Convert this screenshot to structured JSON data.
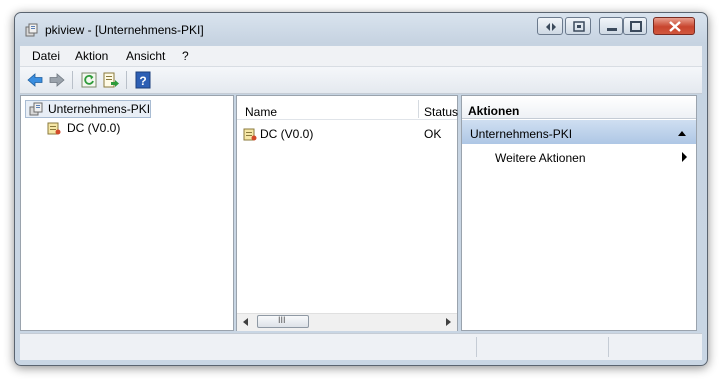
{
  "window": {
    "title": "pkiview - [Unternehmens-PKI]",
    "colors": {
      "frame": "#c9d6e4",
      "selection": "#b8cde8",
      "close": "#c8452e"
    }
  },
  "menu": {
    "items": [
      "Datei",
      "Aktion",
      "Ansicht",
      "?"
    ]
  },
  "toolbar": {
    "icons": [
      "back-arrow-icon",
      "forward-arrow-icon",
      "refresh-icon",
      "export-list-icon",
      "help-icon"
    ]
  },
  "tree": {
    "root": "Unternehmens-PKI",
    "children": [
      "DC (V0.0)"
    ]
  },
  "list": {
    "columns": [
      "Name",
      "Status"
    ],
    "rows": [
      {
        "name": "DC (V0.0)",
        "status": "OK"
      }
    ],
    "scrollbar_thumb": "III"
  },
  "actions": {
    "header": "Aktionen",
    "section": "Unternehmens-PKI",
    "items": [
      "Weitere Aktionen"
    ]
  }
}
